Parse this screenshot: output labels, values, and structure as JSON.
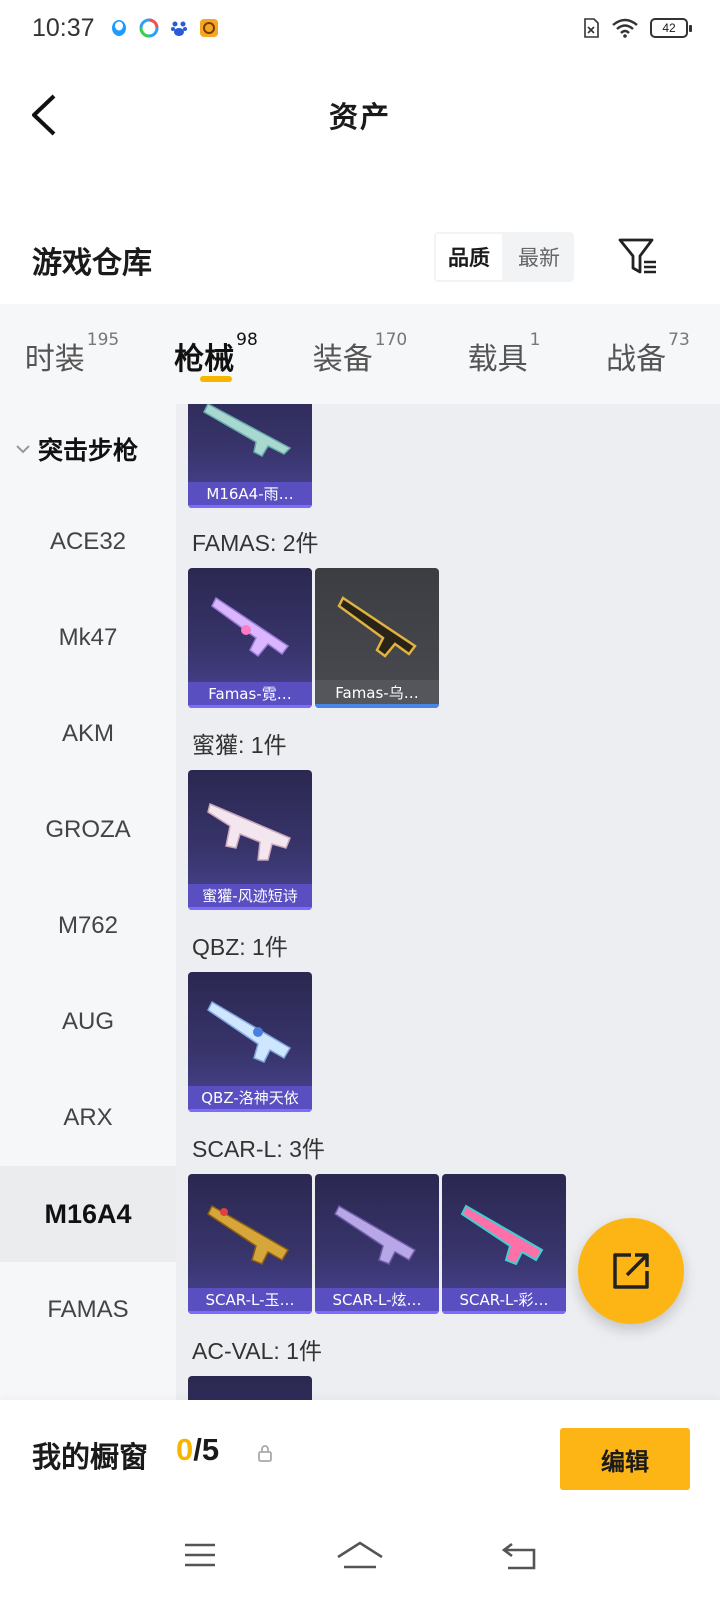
{
  "status_bar": {
    "time": "10:37",
    "battery": "42",
    "icons": [
      "qq-icon",
      "browser-icon",
      "baidu-icon",
      "app-icon"
    ]
  },
  "header": {
    "title": "资产",
    "back_icon": "chevron-left-icon"
  },
  "section": {
    "title": "游戏仓库",
    "sort_options": [
      "品质",
      "最新"
    ],
    "sort_active": "品质",
    "filter_icon": "filter-icon"
  },
  "tabs": [
    {
      "label": "时装",
      "count": "195"
    },
    {
      "label": "枪械",
      "count": "98",
      "active": true
    },
    {
      "label": "装备",
      "count": "170"
    },
    {
      "label": "载具",
      "count": "1"
    },
    {
      "label": "战备",
      "count": "73"
    }
  ],
  "sidebar": {
    "group": "突击步枪",
    "items": [
      "ACE32",
      "Mk47",
      "AKM",
      "GROZA",
      "M762",
      "AUG",
      "ARX",
      "M16A4",
      "FAMAS"
    ],
    "active": "M16A4"
  },
  "content": {
    "top_card": "M16A4-雨…",
    "groups": [
      {
        "title": "FAMAS: 2件",
        "cards": [
          "Famas-霓…",
          "Famas-乌…"
        ]
      },
      {
        "title": "蜜獾: 1件",
        "cards": [
          "蜜獾-风迹短诗"
        ]
      },
      {
        "title": "QBZ: 1件",
        "cards": [
          "QBZ-洛神天依"
        ]
      },
      {
        "title": "SCAR-L: 3件",
        "cards": [
          "SCAR-L-玉…",
          "SCAR-L-炫…",
          "SCAR-L-彩…"
        ]
      },
      {
        "title": "AC-VAL: 1件",
        "cards": []
      }
    ]
  },
  "fab": {
    "icon": "share-out-icon"
  },
  "bottom": {
    "label": "我的橱窗",
    "current": "0",
    "total": "/5",
    "lock_icon": "lock-icon",
    "edit_label": "编辑"
  },
  "navbar": {
    "icons": [
      "menu-icon",
      "home-icon",
      "back-icon"
    ]
  },
  "colors": {
    "accent": "#fdb515",
    "card_caption": "#5a4fc0"
  }
}
